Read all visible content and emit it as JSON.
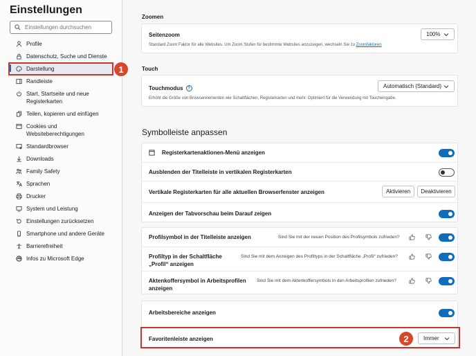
{
  "sidebar": {
    "title": "Einstellungen",
    "search_placeholder": "Einstellungen durchsuchen",
    "items": [
      {
        "label": "Profile",
        "icon": "person-icon"
      },
      {
        "label": "Datenschutz, Suche und Dienste",
        "icon": "lock-icon"
      },
      {
        "label": "Darstellung",
        "icon": "palette-icon",
        "active": true
      },
      {
        "label": "Randleiste",
        "icon": "sidebar-icon"
      },
      {
        "label": "Start, Startseite und neue Registerkarten",
        "icon": "power-icon"
      },
      {
        "label": "Teilen, kopieren und einfügen",
        "icon": "share-icon"
      },
      {
        "label": "Cookies und Websiteberechtigungen",
        "icon": "cookie-icon"
      },
      {
        "label": "Standardbrowser",
        "icon": "browser-icon"
      },
      {
        "label": "Downloads",
        "icon": "download-icon"
      },
      {
        "label": "Family Safety",
        "icon": "family-icon"
      },
      {
        "label": "Sprachen",
        "icon": "language-icon"
      },
      {
        "label": "Drucker",
        "icon": "printer-icon"
      },
      {
        "label": "System und Leistung",
        "icon": "system-icon"
      },
      {
        "label": "Einstellungen zurücksetzen",
        "icon": "reset-icon"
      },
      {
        "label": "Smartphone und andere Geräte",
        "icon": "phone-icon"
      },
      {
        "label": "Barrierefreiheit",
        "icon": "accessibility-icon"
      },
      {
        "label": "Infos zu Microsoft Edge",
        "icon": "edge-icon"
      }
    ]
  },
  "badges": {
    "one": "1",
    "two": "2"
  },
  "zoom": {
    "section": "Zoomen",
    "label": "Seitenzoom",
    "desc": "Standard Zoom Faktor für alle Websites. Um Zoom Stufen für bestimmte Websites anzuzeigen, wechseln Sie zu",
    "link": "Zoomfaktoren",
    "value": "100%"
  },
  "touch": {
    "section": "Touch",
    "label": "Touchmodus",
    "desc": "Erhöht die Größe von Browserelementen wie Schaltflächen, Registerkarten und mehr. Optimiert für die Verwendung mit Toucheingabe.",
    "value": "Automatisch (Standard)"
  },
  "toolbar": {
    "title": "Symbolleiste anpassen",
    "rows": {
      "tab_actions": "Registerkartenaktionen-Menü anzeigen",
      "hide_titlebar": "Ausblenden der Titelleiste in vertikalen Registerkarten",
      "vertical_tabs": "Vertikale Registerkarten für alle aktuellen Browserfenster anzeigen",
      "activate": "Aktivieren",
      "deactivate": "Deaktivieren",
      "tab_preview": "Anzeigen der Tabvorschau beim Darauf zeigen",
      "profile_icon": "Profilsymbol in der Titelleiste anzeigen",
      "profile_icon_q": "Sind Sie mit der neuen Position des Profilsymbols zufrieden?",
      "profile_type": "Profiltyp in der Schaltfläche „Profil“ anzeigen",
      "profile_type_q": "Sind Sie mit dem Anzeigen des Profiltyps in der Schaltfläche „Profil“ zufrieden?",
      "briefcase": "Aktenkoffersymbol in Arbeitsprofilen anzeigen",
      "briefcase_q": "Sind Sie mit dem Aktenkoffersymbols in den Arbeitsprofilen zufrieden?",
      "workspaces": "Arbeitsbereiche anzeigen",
      "favorites": "Favoritenleiste anzeigen",
      "favorites_value": "Immer"
    }
  }
}
